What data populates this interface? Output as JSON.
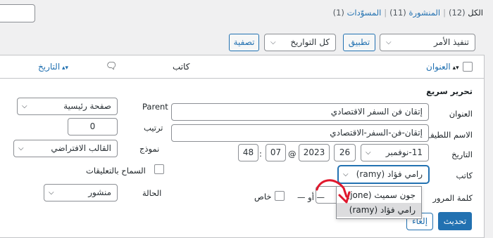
{
  "subsubsub": {
    "all": "الكل",
    "all_count": "(12)",
    "published": "المنشورة",
    "published_count": "(11)",
    "drafts": "المسوّدات",
    "drafts_count": "(1)",
    "separator": "|"
  },
  "toolbar": {
    "bulk_action": "تنفيذ الأمر",
    "apply": "تطبيق",
    "dates": "كل التواريخ",
    "filter": "تصفية"
  },
  "table": {
    "col_title": "العنوان",
    "col_author": "كاتب",
    "col_date": "التاريخ"
  },
  "quick_edit": {
    "heading": "تحرير سريع",
    "title_label": "العنوان",
    "title_value": "إتقان فن السفر الاقتصادي",
    "slug_label": "الاسم اللطيف",
    "slug_value": "إتقان-فن-السفر-الاقتصادي",
    "date_label": "التاريخ",
    "month_value": "11-نوفمبر",
    "day_value": "26",
    "year_value": "2023",
    "at": "@",
    "hour_value": "07",
    "colon": ":",
    "minute_value": "48",
    "author_label": "كاتب",
    "author_value": "رامي فؤاد (ramy)",
    "author_options": [
      "جون سميث (jone)",
      "رامي فؤاد (ramy)"
    ],
    "password_label": "كلمة المرور",
    "or": "— أو —",
    "private_label": "خاص",
    "parent_label": "Parent",
    "parent_value": "صفحة رئيسية",
    "order_label": "ترتيب",
    "order_value": "0",
    "template_label": "نموذج",
    "template_value": "القالب الافتراضي",
    "comments_label": "السماح بالتعليقات",
    "status_label": "الحالة",
    "status_value": "منشور",
    "update_button": "تحديث",
    "cancel_button": "إلغاء"
  },
  "colors": {
    "accent": "#2271b1",
    "annotation": "#e0182d"
  }
}
